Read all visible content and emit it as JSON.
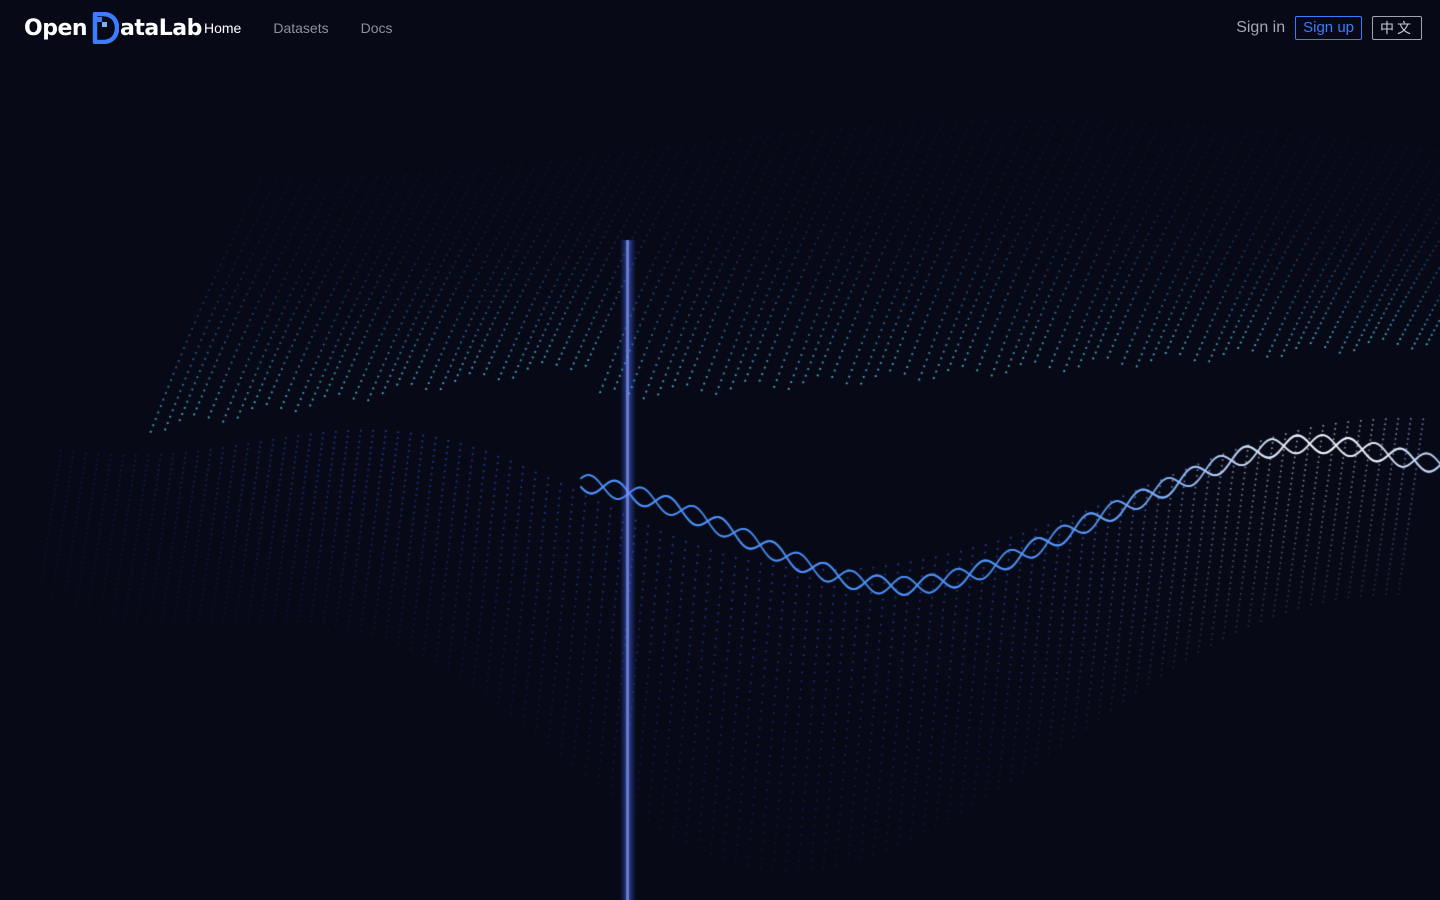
{
  "brand": {
    "logo_prefix": "Open",
    "logo_suffix": "ataLab",
    "logo_mark_icon": "data-d-icon",
    "accent_color": "#3d7bff"
  },
  "nav": {
    "links": [
      {
        "label": "Home",
        "active": true
      },
      {
        "label": "Datasets",
        "active": false
      },
      {
        "label": "Docs",
        "active": false
      }
    ]
  },
  "auth": {
    "sign_in": "Sign in",
    "sign_up": "Sign up"
  },
  "language_toggle": "中文",
  "hero": {
    "visual": "particle-wave-visualization",
    "background_color": "#070a16",
    "particle_colors": [
      "#2a3fd8",
      "#3f7cff",
      "#5fc4ff",
      "#e6ecff"
    ]
  }
}
